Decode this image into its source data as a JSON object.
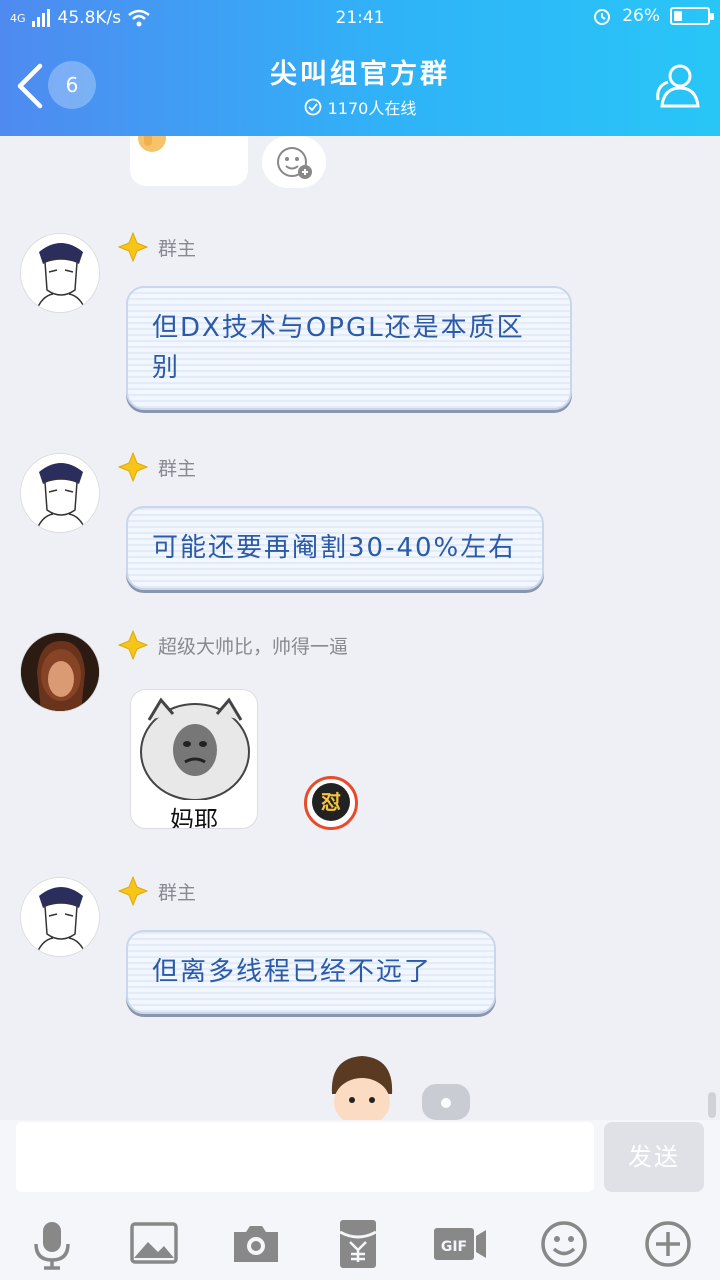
{
  "status_bar": {
    "network": "4G",
    "speed": "45.8K/s",
    "time": "21:41",
    "battery": "26%",
    "battery_level": 0.26
  },
  "header": {
    "unread_count": "6",
    "title": "尖叫组官方群",
    "online": "1170人在线"
  },
  "messages": [
    {
      "sender": "群主",
      "text": "但DX技术与OPGL还是本质区别"
    },
    {
      "sender": "群主",
      "text": "可能还要再阉割30-40%左右"
    },
    {
      "sender": "超级大帅比，帅得一逼",
      "sticker_caption": "妈耶"
    },
    {
      "sender": "群主",
      "text": "但离多线程已经不远了"
    }
  ],
  "reaction_badge": "怼",
  "input": {
    "placeholder": "",
    "send_label": "发送"
  },
  "toolbar": [
    "mic-icon",
    "image-icon",
    "camera-icon",
    "red-packet-icon",
    "gif-icon",
    "emoji-icon",
    "plus-icon"
  ],
  "colors": {
    "header_start": "#4f8af0",
    "header_end": "#28c6f7",
    "bubble_text": "#2a5aa8",
    "crown": "#f7c51a"
  }
}
